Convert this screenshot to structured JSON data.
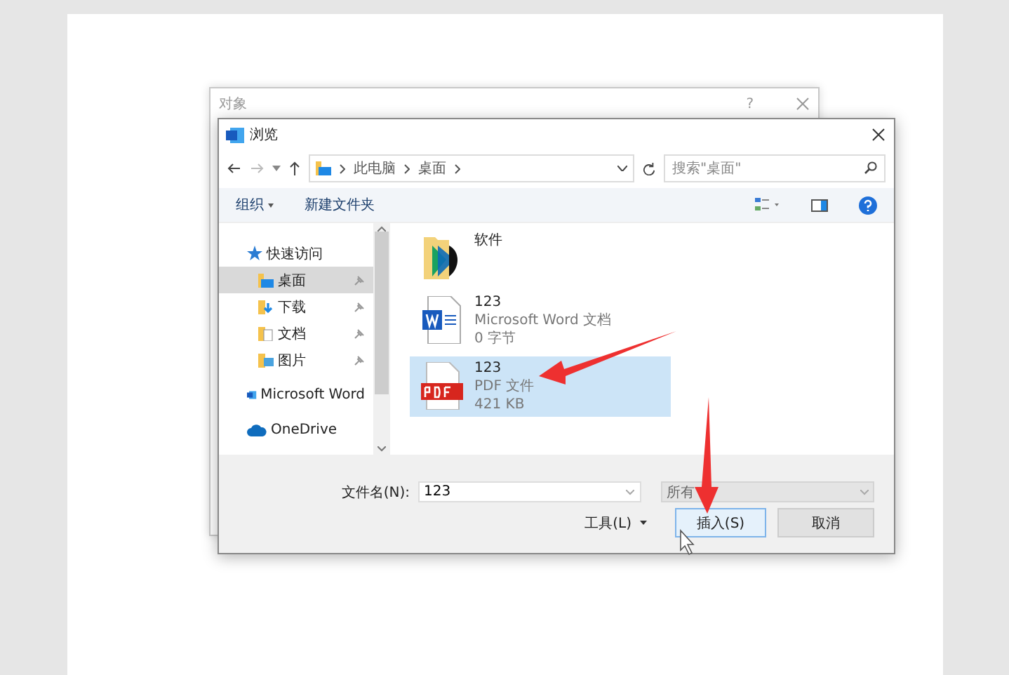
{
  "back_dialog": {
    "title": "对象",
    "help": "?"
  },
  "dialog": {
    "title": "浏览",
    "nav": {
      "path": [
        "此电脑",
        "桌面"
      ],
      "search": {
        "placeholder": "搜索\"桌面\""
      }
    },
    "toolbar": {
      "organize": "组织",
      "new_folder": "新建文件夹"
    },
    "sidebar": [
      {
        "label": "快速访问",
        "kind": "star",
        "selected": false,
        "children": [
          {
            "label": "桌面",
            "kind": "desktop",
            "selected": true,
            "pinned": true
          },
          {
            "label": "下载",
            "kind": "download",
            "selected": false,
            "pinned": true
          },
          {
            "label": "文档",
            "kind": "docs",
            "selected": false,
            "pinned": true
          },
          {
            "label": "图片",
            "kind": "pics",
            "selected": false,
            "pinned": true
          }
        ]
      },
      {
        "label": "Microsoft Word",
        "kind": "word",
        "selected": false
      },
      {
        "label": "OneDrive",
        "kind": "cloud",
        "selected": false
      }
    ],
    "files": [
      {
        "name": "软件",
        "kind": "folder",
        "selected": false
      },
      {
        "name": "123",
        "type": "Microsoft Word 文档",
        "size": "0 字节",
        "kind": "word",
        "selected": false
      },
      {
        "name": "123",
        "type": "PDF 文件",
        "size": "421 KB",
        "kind": "pdf",
        "selected": true
      }
    ],
    "filename": {
      "label": "文件名(N):",
      "value": "123"
    },
    "filetype": "所有",
    "tools": "工具(L)",
    "buttons": [
      {
        "label": "插入(S)",
        "primary": true
      },
      {
        "label": "取消",
        "primary": false
      }
    ]
  }
}
